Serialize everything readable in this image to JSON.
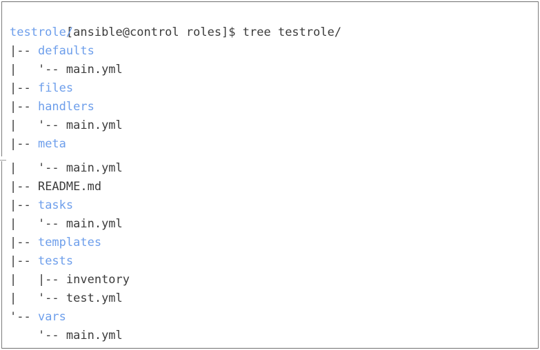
{
  "terminal": {
    "prompt_line": "[ansible@control roles]$ tree testrole/",
    "prompt": "[ansible@control roles]$",
    "command": "tree testrole/",
    "colors": {
      "background": "#ffffff",
      "foreground": "#3b3b3b",
      "directory": "#6d9eeb",
      "border": "#6e6e6e"
    },
    "output_lines": [
      {
        "prefix": "",
        "name": "testrole/",
        "kind": "directory"
      },
      {
        "prefix": "|-- ",
        "name": "defaults",
        "kind": "directory"
      },
      {
        "prefix": "|   '-- ",
        "name": "main.yml",
        "kind": "file"
      },
      {
        "prefix": "|-- ",
        "name": "files",
        "kind": "directory"
      },
      {
        "prefix": "|-- ",
        "name": "handlers",
        "kind": "directory"
      },
      {
        "prefix": "|   '-- ",
        "name": "main.yml",
        "kind": "file"
      },
      {
        "prefix": "|-- ",
        "name": "meta",
        "kind": "directory"
      },
      {
        "prefix": "|   '-- ",
        "name": "main.yml",
        "kind": "file"
      },
      {
        "prefix": "|-- ",
        "name": "README.md",
        "kind": "file"
      },
      {
        "prefix": "|-- ",
        "name": "tasks",
        "kind": "directory"
      },
      {
        "prefix": "|   '-- ",
        "name": "main.yml",
        "kind": "file"
      },
      {
        "prefix": "|-- ",
        "name": "templates",
        "kind": "directory"
      },
      {
        "prefix": "|-- ",
        "name": "tests",
        "kind": "directory"
      },
      {
        "prefix": "|   |-- ",
        "name": "inventory",
        "kind": "file"
      },
      {
        "prefix": "|   '-- ",
        "name": "test.yml",
        "kind": "file"
      },
      {
        "prefix": "'-- ",
        "name": "vars",
        "kind": "directory"
      },
      {
        "prefix": "    '-- ",
        "name": "main.yml",
        "kind": "file"
      }
    ]
  }
}
